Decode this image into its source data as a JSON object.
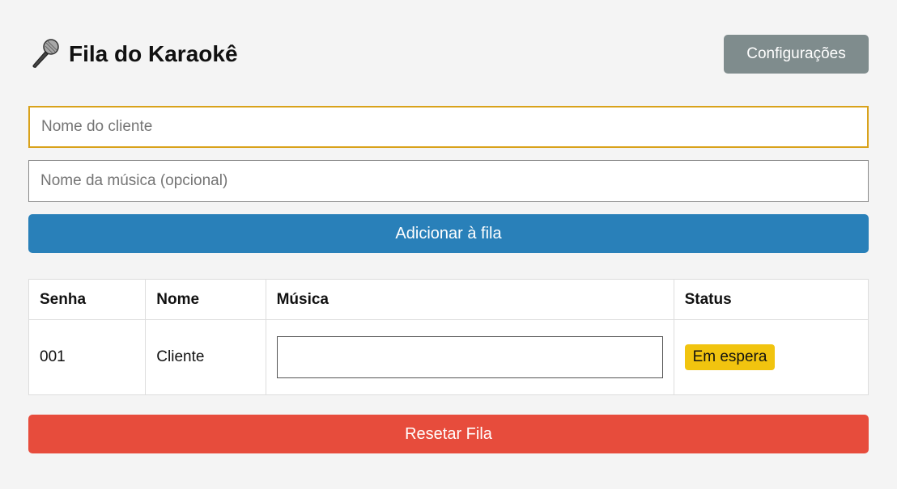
{
  "header": {
    "icon": "microphone-icon",
    "title": "Fila do Karaokê",
    "settings_label": "Configurações"
  },
  "form": {
    "client_placeholder": "Nome do cliente",
    "song_placeholder": "Nome da música (opcional)",
    "add_label": "Adicionar à fila"
  },
  "table": {
    "headers": [
      "Senha",
      "Nome",
      "Música",
      "Status"
    ],
    "rows": [
      {
        "senha": "001",
        "nome": "Cliente",
        "musica": "",
        "status": "Em espera"
      }
    ]
  },
  "reset_label": "Resetar Fila",
  "colors": {
    "settings": "#7f8c8d",
    "add": "#2980b9",
    "reset": "#e74c3c",
    "status_waiting": "#f1c40f",
    "focus": "#d9a21b"
  }
}
